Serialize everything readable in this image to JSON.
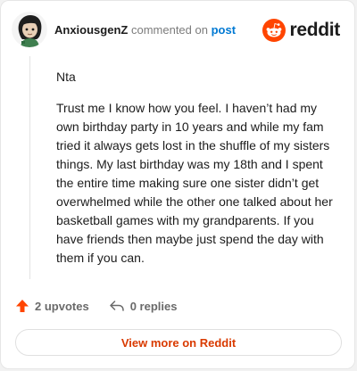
{
  "header": {
    "username": "AnxiousgenZ",
    "action_text": "commented on",
    "post_link": "post",
    "brand": "reddit"
  },
  "comment": {
    "paragraphs": [
      "Nta",
      "Trust me I know how you feel. I haven’t had my own birthday party in 10 years and while my fam tried it always gets lost in the shuffle of my sisters things. My last birthday was my 18th and I spent the entire time making sure one sister didn’t get overwhelmed while the other one talked about her basketball games with my grandparents. If you have friends then maybe just spend the day with them if you can."
    ]
  },
  "actions": {
    "upvotes": "2 upvotes",
    "replies": "0 replies"
  },
  "footer": {
    "view_more": "View more on Reddit"
  },
  "colors": {
    "brand_orange": "#ff4500",
    "link_blue": "#0079d3",
    "upvote_red": "#ff4500"
  }
}
